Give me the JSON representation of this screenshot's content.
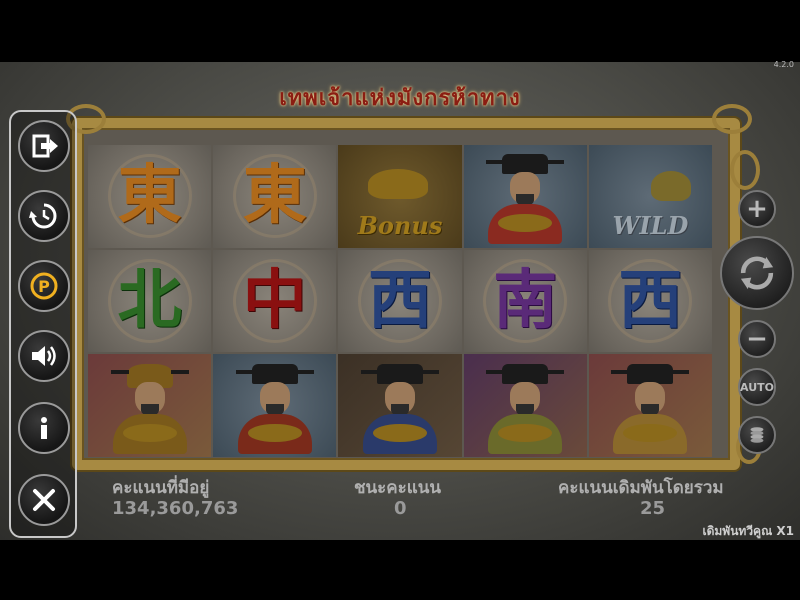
{
  "version": "4.2.0",
  "game": {
    "title": "เทพเจ้าแห่งมังกรห้าทาง"
  },
  "reels": [
    [
      {
        "symbol": "東",
        "kind": "glyph",
        "color": "orange"
      },
      {
        "symbol": "東",
        "kind": "glyph",
        "color": "orange"
      },
      {
        "symbol": "bonus",
        "kind": "bonus",
        "label": "Bonus"
      },
      {
        "symbol": "god-blue",
        "kind": "god"
      },
      {
        "symbol": "wild",
        "kind": "wild",
        "label": "WILD"
      }
    ],
    [
      {
        "symbol": "北",
        "kind": "glyph",
        "color": "green"
      },
      {
        "symbol": "中",
        "kind": "glyph",
        "color": "red"
      },
      {
        "symbol": "西",
        "kind": "glyph",
        "color": "blue"
      },
      {
        "symbol": "南",
        "kind": "glyph",
        "color": "purple"
      },
      {
        "symbol": "西",
        "kind": "glyph",
        "color": "blue"
      }
    ],
    [
      {
        "symbol": "general",
        "kind": "general"
      },
      {
        "symbol": "god-gold",
        "kind": "god"
      },
      {
        "symbol": "god-dark",
        "kind": "god"
      },
      {
        "symbol": "god-purple",
        "kind": "god"
      },
      {
        "symbol": "god-red",
        "kind": "god"
      }
    ]
  ],
  "left_menu": [
    {
      "name": "exit-icon"
    },
    {
      "name": "history-icon"
    },
    {
      "name": "paytable-icon"
    },
    {
      "name": "sound-icon"
    },
    {
      "name": "info-icon"
    },
    {
      "name": "close-icon"
    }
  ],
  "right_controls": {
    "increase": "+",
    "decrease": "−",
    "auto_label": "AUTO"
  },
  "info": {
    "balance_label": "คะแนนที่มีอยู่",
    "balance_value": "134,360,763",
    "win_label": "ชนะคะแนน",
    "win_value": "0",
    "total_bet_label": "คะแนนเดิมพันโดยรวม",
    "total_bet_value": "25",
    "bet_multiplier": "เดิมพันทวีคูณ X1"
  },
  "colors": {
    "title": "#8b1d12",
    "frame": "#a78a42",
    "menu_border": "#c8c8c8"
  }
}
